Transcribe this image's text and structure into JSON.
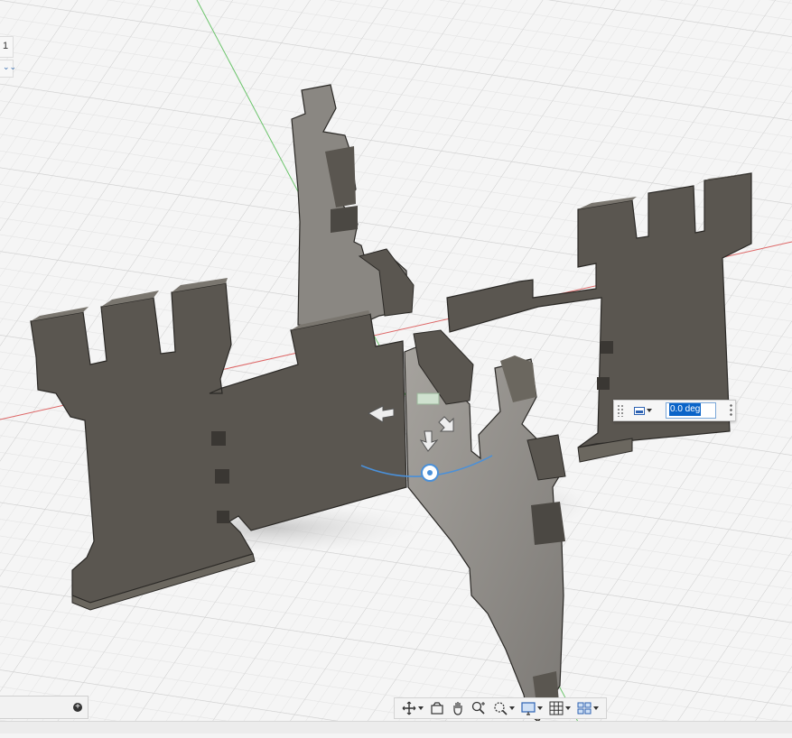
{
  "viewport": {
    "colors": {
      "background": "#f4f4f4",
      "grid_minor": "#e0e0e0",
      "grid_major": "#cfcfcf",
      "x_axis": "#d05050",
      "y_axis": "#5fbf5f",
      "part_face": "#5a5650",
      "part_side": "#6b675f",
      "part_top": "#7a766f",
      "selected_face": "#8e8b86",
      "gizmo": "#4a90d9"
    },
    "side_panel_tag": "1",
    "rotation_input": {
      "value": "0.0 deg",
      "mode_icon": "angle-mode-icon"
    }
  },
  "navigation_toolbar": {
    "items": [
      {
        "name": "orbit-icon",
        "has_dropdown": true
      },
      {
        "name": "look-at-icon",
        "has_dropdown": false
      },
      {
        "name": "pan-icon",
        "has_dropdown": false
      },
      {
        "name": "zoom-icon",
        "has_dropdown": false
      },
      {
        "name": "fit-icon",
        "has_dropdown": true
      },
      {
        "name": "display-settings-icon",
        "has_dropdown": true
      },
      {
        "name": "grid-settings-icon",
        "has_dropdown": true
      },
      {
        "name": "viewports-icon",
        "has_dropdown": true
      }
    ]
  }
}
